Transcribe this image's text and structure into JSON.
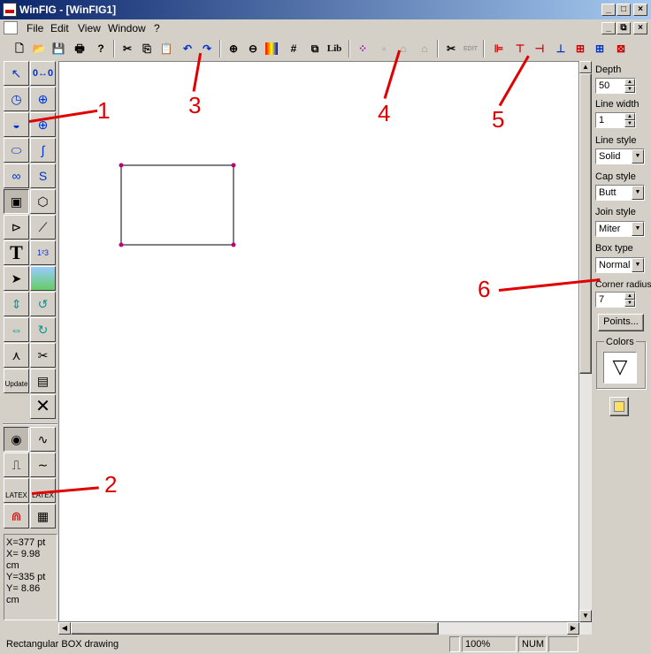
{
  "title": "WinFIG - [WinFIG1]",
  "menu": [
    "File",
    "Edit",
    "View",
    "Window",
    "?"
  ],
  "toolbar": {
    "lib_label": "Lib",
    "edit_label": "EDIT"
  },
  "palette": {
    "update_label": "Update",
    "latex1": "LATEX",
    "latex2": "LATEX"
  },
  "coords": [
    "X=377 pt",
    "X= 9.98 cm",
    "Y=335 pt",
    "Y= 8.86 cm"
  ],
  "side": {
    "depth_label": "Depth",
    "depth_value": "50",
    "linewidth_label": "Line width",
    "linewidth_value": "1",
    "linestyle_label": "Line style",
    "linestyle_value": "Solid",
    "capstyle_label": "Cap style",
    "capstyle_value": "Butt",
    "joinstyle_label": "Join style",
    "joinstyle_value": "Miter",
    "boxtype_label": "Box type",
    "boxtype_value": "Normal",
    "corner_label": "Corner radius",
    "corner_value": "7",
    "points_label": "Points...",
    "colors_label": "Colors"
  },
  "status": {
    "message": "Rectangular BOX drawing",
    "zoom": "100%",
    "num": "NUM"
  },
  "annotations": [
    "1",
    "2",
    "3",
    "4",
    "5",
    "6"
  ],
  "colors": {
    "title_start": "#0a246a",
    "title_end": "#a6caf0",
    "annotation": "#e00000",
    "handle": "#c0007a"
  }
}
